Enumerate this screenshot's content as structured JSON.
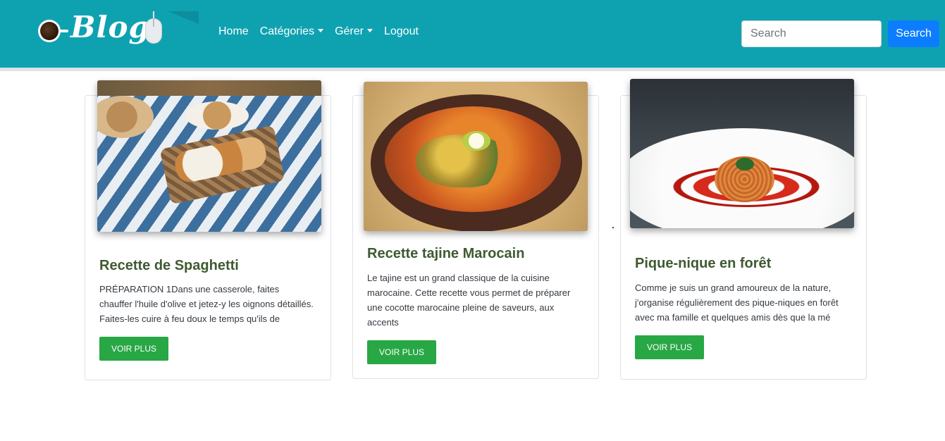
{
  "navbar": {
    "brand": "Blog",
    "links": [
      {
        "label": "Home",
        "dropdown": false
      },
      {
        "label": "Catégories",
        "dropdown": true
      },
      {
        "label": "Gérer",
        "dropdown": true
      },
      {
        "label": "Logout",
        "dropdown": false
      }
    ],
    "search": {
      "placeholder": "Search",
      "value": "",
      "button_label": "Search"
    },
    "colors": {
      "bar": "#0ea2b1",
      "search_button": "#0d7dff"
    }
  },
  "cards": [
    {
      "image_icon": "picnic-photo",
      "title": "Recette de Spaghetti",
      "text": "PRÉPARATION 1Dans une casserole, faites chauffer l'huile d'olive et jetez-y les oignons détaillés. Faites-les cuire à feu doux le temps qu'ils de",
      "button_label": "VOIR PLUS"
    },
    {
      "image_icon": "tajine-photo",
      "title": "Recette tajine Marocain",
      "text": "Le tajine est un grand classique de la cuisine marocaine. Cette recette vous permet de préparer une cocotte marocaine pleine de saveurs, aux accents",
      "button_label": "VOIR PLUS"
    },
    {
      "image_icon": "spaghetti-photo",
      "title": "Pique-nique en forêt",
      "text": "Comme je suis un grand amoureux de la nature, j'organise régulièrement des pique-niques en forêt avec ma famille et quelques amis dès que la mé",
      "button_label": "VOIR PLUS"
    }
  ],
  "colors": {
    "card_title": "#3f5a32",
    "button": "#28a745"
  }
}
